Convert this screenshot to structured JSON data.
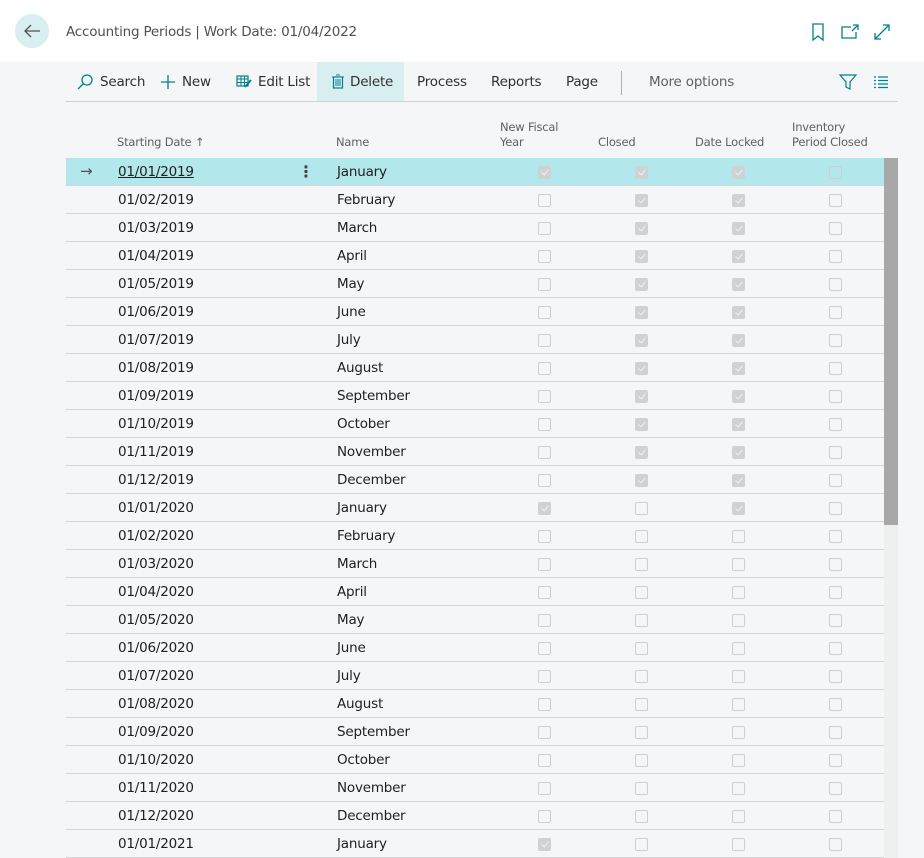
{
  "header": {
    "title": "Accounting Periods | Work Date: 01/04/2022",
    "back_icon": "arrow-left-icon",
    "actions": [
      "bookmark-icon",
      "open-new-window-icon",
      "expand-icon"
    ]
  },
  "toolbar": {
    "search": "Search",
    "new": "New",
    "edit_list": "Edit List",
    "delete": "Delete",
    "process": "Process",
    "reports": "Reports",
    "page": "Page",
    "more_options": "More options",
    "filter_icon": "filter-icon",
    "list_icon": "list-view-icon"
  },
  "colors": {
    "accent": "#00828c",
    "selected_row": "#b2e8eb",
    "active_action": "#d8eef0"
  },
  "columns": {
    "starting_date": "Starting Date",
    "sort_indicator": "↑",
    "name": "Name",
    "new_fiscal_year_1": "New Fiscal",
    "new_fiscal_year_2": "Year",
    "closed": "Closed",
    "date_locked": "Date Locked",
    "inventory_1": "Inventory",
    "inventory_2": "Period Closed"
  },
  "rows": [
    {
      "date": "01/01/2019",
      "name": "January",
      "nfy": true,
      "closed": true,
      "locked": true,
      "inv": false,
      "selected": true
    },
    {
      "date": "01/02/2019",
      "name": "February",
      "nfy": false,
      "closed": true,
      "locked": true,
      "inv": false
    },
    {
      "date": "01/03/2019",
      "name": "March",
      "nfy": false,
      "closed": true,
      "locked": true,
      "inv": false
    },
    {
      "date": "01/04/2019",
      "name": "April",
      "nfy": false,
      "closed": true,
      "locked": true,
      "inv": false
    },
    {
      "date": "01/05/2019",
      "name": "May",
      "nfy": false,
      "closed": true,
      "locked": true,
      "inv": false
    },
    {
      "date": "01/06/2019",
      "name": "June",
      "nfy": false,
      "closed": true,
      "locked": true,
      "inv": false
    },
    {
      "date": "01/07/2019",
      "name": "July",
      "nfy": false,
      "closed": true,
      "locked": true,
      "inv": false
    },
    {
      "date": "01/08/2019",
      "name": "August",
      "nfy": false,
      "closed": true,
      "locked": true,
      "inv": false
    },
    {
      "date": "01/09/2019",
      "name": "September",
      "nfy": false,
      "closed": true,
      "locked": true,
      "inv": false
    },
    {
      "date": "01/10/2019",
      "name": "October",
      "nfy": false,
      "closed": true,
      "locked": true,
      "inv": false
    },
    {
      "date": "01/11/2019",
      "name": "November",
      "nfy": false,
      "closed": true,
      "locked": true,
      "inv": false
    },
    {
      "date": "01/12/2019",
      "name": "December",
      "nfy": false,
      "closed": true,
      "locked": true,
      "inv": false
    },
    {
      "date": "01/01/2020",
      "name": "January",
      "nfy": true,
      "closed": false,
      "locked": true,
      "inv": false
    },
    {
      "date": "01/02/2020",
      "name": "February",
      "nfy": false,
      "closed": false,
      "locked": false,
      "inv": false
    },
    {
      "date": "01/03/2020",
      "name": "March",
      "nfy": false,
      "closed": false,
      "locked": false,
      "inv": false
    },
    {
      "date": "01/04/2020",
      "name": "April",
      "nfy": false,
      "closed": false,
      "locked": false,
      "inv": false
    },
    {
      "date": "01/05/2020",
      "name": "May",
      "nfy": false,
      "closed": false,
      "locked": false,
      "inv": false
    },
    {
      "date": "01/06/2020",
      "name": "June",
      "nfy": false,
      "closed": false,
      "locked": false,
      "inv": false
    },
    {
      "date": "01/07/2020",
      "name": "July",
      "nfy": false,
      "closed": false,
      "locked": false,
      "inv": false
    },
    {
      "date": "01/08/2020",
      "name": "August",
      "nfy": false,
      "closed": false,
      "locked": false,
      "inv": false
    },
    {
      "date": "01/09/2020",
      "name": "September",
      "nfy": false,
      "closed": false,
      "locked": false,
      "inv": false
    },
    {
      "date": "01/10/2020",
      "name": "October",
      "nfy": false,
      "closed": false,
      "locked": false,
      "inv": false
    },
    {
      "date": "01/11/2020",
      "name": "November",
      "nfy": false,
      "closed": false,
      "locked": false,
      "inv": false
    },
    {
      "date": "01/12/2020",
      "name": "December",
      "nfy": false,
      "closed": false,
      "locked": false,
      "inv": false
    },
    {
      "date": "01/01/2021",
      "name": "January",
      "nfy": true,
      "closed": false,
      "locked": false,
      "inv": false
    }
  ]
}
